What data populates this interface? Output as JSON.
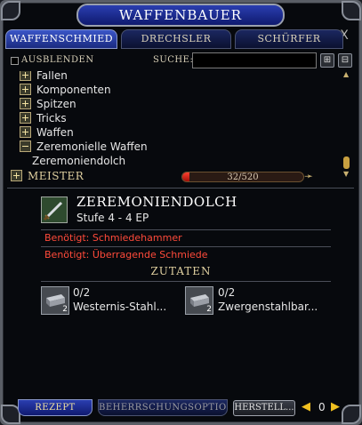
{
  "window": {
    "title": "Waffenbauer",
    "close_glyph": "X"
  },
  "tabs": [
    {
      "label": "Waffenschmied",
      "active": true
    },
    {
      "label": "Drechsler",
      "active": false
    },
    {
      "label": "Schürfer",
      "active": false
    }
  ],
  "filter": {
    "hide_label": "Ausblenden",
    "hide_checked": false,
    "search_label": "Suche:",
    "search_value": "",
    "search_placeholder": ""
  },
  "tree": {
    "items": [
      {
        "label": "Fallen",
        "state": "collapsed"
      },
      {
        "label": "Komponenten",
        "state": "collapsed"
      },
      {
        "label": "Spitzen",
        "state": "collapsed"
      },
      {
        "label": "Tricks",
        "state": "collapsed"
      },
      {
        "label": "Waffen",
        "state": "collapsed"
      },
      {
        "label": "Zeremonielle Waffen",
        "state": "expanded"
      },
      {
        "label": "Zeremoniendolch",
        "state": "leaf"
      }
    ]
  },
  "proficiency": {
    "label": "Meister",
    "current": 32,
    "max": 520,
    "text": "32/520"
  },
  "recipe": {
    "title": "Zeremoniendolch",
    "subtitle": "Stufe 4 - 4 EP",
    "requirements": [
      "Benötigt: Schmiedehammer",
      "Benötigt: Überragende Schmiede"
    ],
    "ingredients_header": "Zutaten",
    "ingredients": [
      {
        "qty": "0/2",
        "name": "Westernis-Stahl...",
        "badge": "2",
        "icon": "metal-bar-icon"
      },
      {
        "qty": "0/2",
        "name": "Zwergenstahlbar...",
        "badge": "2",
        "icon": "metal-bar-icon"
      }
    ]
  },
  "bottom": {
    "tab_recipe": "Rezept",
    "tab_mastery": "Beherrschungsoptio...",
    "craft_label": "Herstell...",
    "quantity": "0"
  },
  "colors": {
    "accent_blue": "#2a3eb0",
    "requirement_red": "#ff4a3a",
    "gold_text": "#e0d0a0",
    "progress_red": "#ff4030"
  }
}
